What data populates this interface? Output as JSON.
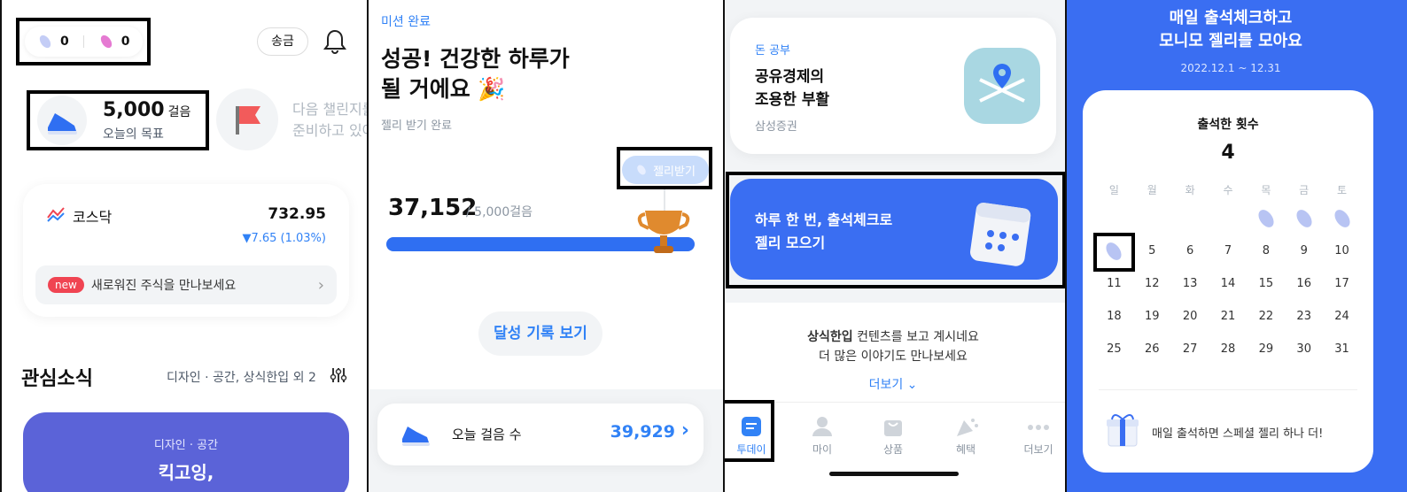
{
  "p1": {
    "jelly1_count": "0",
    "jelly2_count": "0",
    "send_label": "송금",
    "steps_value": "5,000",
    "steps_unit": "걸음",
    "steps_goal_label": "오늘의 목표",
    "challenge_line1": "다음 챌린지를",
    "challenge_line2": "준비하고 있어",
    "index_name": "코스닥",
    "index_value": "732.95",
    "index_change": "▼7.65 (1.03%)",
    "new_badge": "new",
    "new_stocks": "새로워진 주식을 만나보세요",
    "interest_title": "관심소식",
    "interest_tags": "디자인 · 공간, 상식한입 외 2",
    "feature_category": "디자인 · 공간",
    "feature_title": "킥고잉,"
  },
  "p2": {
    "mission_label": "미션 완료",
    "headline1": "성공! 건강한 하루가",
    "headline2": "될 거에요 🎉",
    "jelly_done": "젤리 받기 완료",
    "jelly_btn": "젤리받기",
    "steps": "37,152",
    "goal": "/ 5,000걸음",
    "progress": 1.0,
    "history_btn": "달성 기록 보기",
    "today_steps_label": "오늘 걸음 수",
    "today_steps_value": "39,929",
    "chevron": "›"
  },
  "p3": {
    "money_tag": "돈 공부",
    "article_title1": "공유경제의",
    "article_title2": "조용한 부활",
    "article_source": "삼성증권",
    "attend_line1": "하루 한 번, 출석체크로",
    "attend_line2": "젤리 모으기",
    "seen_prefix": "상식한입",
    "seen_suffix": " 컨텐츠를 보고 계시네요",
    "more_stories": "더 많은 이야기도 만나보세요",
    "more_btn": "더보기 ⌄",
    "nav": [
      {
        "label": "투데이",
        "icon": "today-icon"
      },
      {
        "label": "마이",
        "icon": "person-icon"
      },
      {
        "label": "상품",
        "icon": "bag-icon"
      },
      {
        "label": "혜택",
        "icon": "party-icon"
      },
      {
        "label": "더보기",
        "icon": "more-icon"
      }
    ]
  },
  "p4": {
    "title1": "매일 출석체크하고",
    "title2": "모니모 젤리를 모아요",
    "period": "2022.12.1 ~ 12.31",
    "count_label": "출석한 횟수",
    "count": "4",
    "weekdays": [
      "일",
      "월",
      "화",
      "수",
      "목",
      "금",
      "토"
    ],
    "rows": [
      [
        "",
        "",
        "",
        "",
        "J",
        "J",
        "J"
      ],
      [
        "J",
        "5",
        "6",
        "7",
        "8",
        "9",
        "10"
      ],
      [
        "11",
        "12",
        "13",
        "14",
        "15",
        "16",
        "17"
      ],
      [
        "18",
        "19",
        "20",
        "21",
        "22",
        "23",
        "24"
      ],
      [
        "25",
        "26",
        "27",
        "28",
        "29",
        "30",
        "31"
      ]
    ],
    "bonus": "매일 출석하면 스페셜 젤리 하나 더!"
  },
  "colors": {
    "blue": "#3182f6",
    "attend_blue": "#3a6ef2",
    "jelly": "#b8c4f3",
    "feature_purple": "#5b63d8"
  }
}
